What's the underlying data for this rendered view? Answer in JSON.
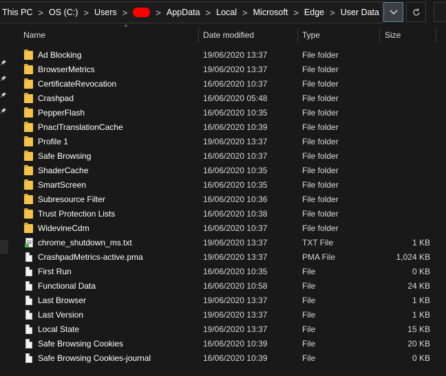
{
  "address": {
    "crumbs": [
      "This PC",
      "OS (C:)",
      "Users",
      "AppData",
      "Local",
      "Microsoft",
      "Edge",
      "User Data"
    ],
    "separator": ">",
    "redaction_color": "#ff0000"
  },
  "buttons": {
    "dropdown_icon": "chevron-down-icon",
    "refresh_icon": "refresh-icon"
  },
  "columns": {
    "name": "Name",
    "date": "Date modified",
    "type": "Type",
    "size": "Size"
  },
  "files": [
    {
      "name": "Ad Blocking",
      "date": "19/06/2020 13:37",
      "type": "File folder",
      "size": "",
      "icon": "folder"
    },
    {
      "name": "BrowserMetrics",
      "date": "19/06/2020 13:37",
      "type": "File folder",
      "size": "",
      "icon": "folder"
    },
    {
      "name": "CertificateRevocation",
      "date": "16/06/2020 10:37",
      "type": "File folder",
      "size": "",
      "icon": "folder"
    },
    {
      "name": "Crashpad",
      "date": "16/06/2020 05:48",
      "type": "File folder",
      "size": "",
      "icon": "folder"
    },
    {
      "name": "PepperFlash",
      "date": "16/06/2020 10:35",
      "type": "File folder",
      "size": "",
      "icon": "folder"
    },
    {
      "name": "PnaclTranslationCache",
      "date": "16/06/2020 10:39",
      "type": "File folder",
      "size": "",
      "icon": "folder"
    },
    {
      "name": "Profile 1",
      "date": "19/06/2020 13:37",
      "type": "File folder",
      "size": "",
      "icon": "folder"
    },
    {
      "name": "Safe Browsing",
      "date": "16/06/2020 10:37",
      "type": "File folder",
      "size": "",
      "icon": "folder"
    },
    {
      "name": "ShaderCache",
      "date": "16/06/2020 10:35",
      "type": "File folder",
      "size": "",
      "icon": "folder"
    },
    {
      "name": "SmartScreen",
      "date": "16/06/2020 10:35",
      "type": "File folder",
      "size": "",
      "icon": "folder"
    },
    {
      "name": "Subresource Filter",
      "date": "16/06/2020 10:36",
      "type": "File folder",
      "size": "",
      "icon": "folder"
    },
    {
      "name": "Trust Protection Lists",
      "date": "16/06/2020 10:38",
      "type": "File folder",
      "size": "",
      "icon": "folder"
    },
    {
      "name": "WidevineCdm",
      "date": "16/06/2020 10:37",
      "type": "File folder",
      "size": "",
      "icon": "folder"
    },
    {
      "name": "chrome_shutdown_ms.txt",
      "date": "19/06/2020 13:37",
      "type": "TXT File",
      "size": "1 KB",
      "icon": "txt"
    },
    {
      "name": "CrashpadMetrics-active.pma",
      "date": "19/06/2020 13:37",
      "type": "PMA File",
      "size": "1,024 KB",
      "icon": "file"
    },
    {
      "name": "First Run",
      "date": "16/06/2020 10:35",
      "type": "File",
      "size": "0 KB",
      "icon": "file"
    },
    {
      "name": "Functional Data",
      "date": "16/06/2020 10:58",
      "type": "File",
      "size": "24 KB",
      "icon": "file"
    },
    {
      "name": "Last Browser",
      "date": "19/06/2020 13:37",
      "type": "File",
      "size": "1 KB",
      "icon": "file"
    },
    {
      "name": "Last Version",
      "date": "19/06/2020 13:37",
      "type": "File",
      "size": "1 KB",
      "icon": "file"
    },
    {
      "name": "Local State",
      "date": "19/06/2020 13:37",
      "type": "File",
      "size": "15 KB",
      "icon": "file"
    },
    {
      "name": "Safe Browsing Cookies",
      "date": "16/06/2020 10:39",
      "type": "File",
      "size": "20 KB",
      "icon": "file"
    },
    {
      "name": "Safe Browsing Cookies-journal",
      "date": "16/06/2020 10:39",
      "type": "File",
      "size": "0 KB",
      "icon": "file"
    }
  ]
}
